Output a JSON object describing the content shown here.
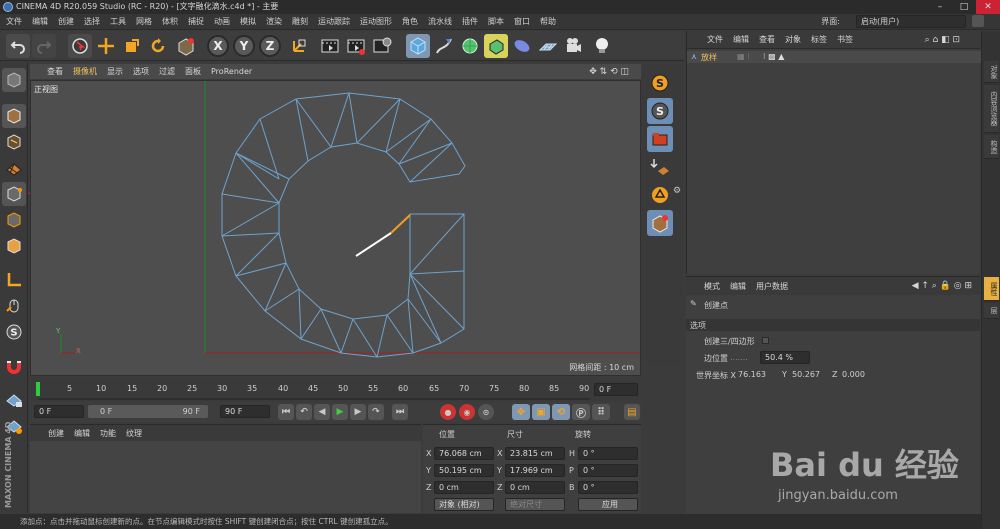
{
  "window": {
    "title": "CINEMA 4D R20.059 Studio (RC - R20) - [文字融化滴水.c4d *] - 主要"
  },
  "menu": [
    "文件",
    "编辑",
    "创建",
    "选择",
    "工具",
    "网格",
    "体积",
    "捕捉",
    "动画",
    "模拟",
    "渲染",
    "雕刻",
    "运动跟踪",
    "运动图形",
    "角色",
    "流水线",
    "插件",
    "脚本",
    "窗口",
    "帮助"
  ],
  "layout": {
    "label": "界面:",
    "value": "启动(用户)"
  },
  "toolbar": {
    "axis_x": "X",
    "axis_y": "Y",
    "axis_z": "Z"
  },
  "viewport": {
    "menu": [
      "查看",
      "摄像机",
      "显示",
      "选项",
      "过滤",
      "面板",
      "ProRender"
    ],
    "name": "正视图",
    "grid_spacing": "网格间距 : 10 cm",
    "axis_y": "Y",
    "axis_x": "X"
  },
  "object_manager": {
    "menu": [
      "文件",
      "编辑",
      "查看",
      "对象",
      "标签",
      "书签"
    ],
    "object_name": "放样"
  },
  "side_tabs": [
    "对象",
    "内容浏览器",
    "构造",
    "属性",
    "层"
  ],
  "attributes": {
    "menu": [
      "模式",
      "编辑",
      "用户数据"
    ],
    "tool_name": "创建点",
    "section": "选项",
    "option1_label": "创建三/四边形",
    "option2_label": "边位置",
    "option2_value": "50.4 %",
    "world_x_label": "世界坐标 X",
    "world_x": "76.163",
    "world_y_label": "Y",
    "world_y": "50.267",
    "world_z_label": "Z",
    "world_z": "0.000"
  },
  "timeline": {
    "ticks": [
      "0",
      "5",
      "10",
      "15",
      "20",
      "25",
      "30",
      "35",
      "40",
      "45",
      "50",
      "55",
      "60",
      "65",
      "70",
      "75",
      "80",
      "85",
      "90"
    ],
    "current_frame": "0 F"
  },
  "animation": {
    "start": "0 F",
    "range_start": "0 F",
    "range_end": "90 F",
    "end": "90 F"
  },
  "material_manager": {
    "menu": [
      "创建",
      "编辑",
      "功能",
      "纹理"
    ]
  },
  "coordinates": {
    "col_position": "位置",
    "col_size": "尺寸",
    "col_rotation": "旋转",
    "pos_x": "76.068 cm",
    "pos_y": "50.195 cm",
    "pos_z": "0 cm",
    "size_x": "23.815 cm",
    "size_y": "17.969 cm",
    "size_z": "0 cm",
    "rot_h": "0 °",
    "rot_p": "0 °",
    "rot_b": "0 °",
    "label_x": "X",
    "label_y": "Y",
    "label_z": "Z",
    "label_h": "H",
    "label_p": "P",
    "label_b": "B",
    "mode": "对象 (相对)",
    "size_mode": "绝对尺寸",
    "apply": "应用"
  },
  "status": {
    "text": "添加点：点击并拖动鼠标创建新的点。在节点编辑模式时按住 SHIFT 键创建闭合点；按住 CTRL 键创建孤立点。"
  },
  "watermark": {
    "brand": "Bai du 经验",
    "url": "jingyan.baidu.com"
  },
  "brand_vertical": "MAXON CINEMA 4D",
  "colors": {
    "accent": "#f0a020",
    "active_tab": "#e8b040",
    "selection": "#7e97b3",
    "mesh": "#6fa2cc"
  }
}
